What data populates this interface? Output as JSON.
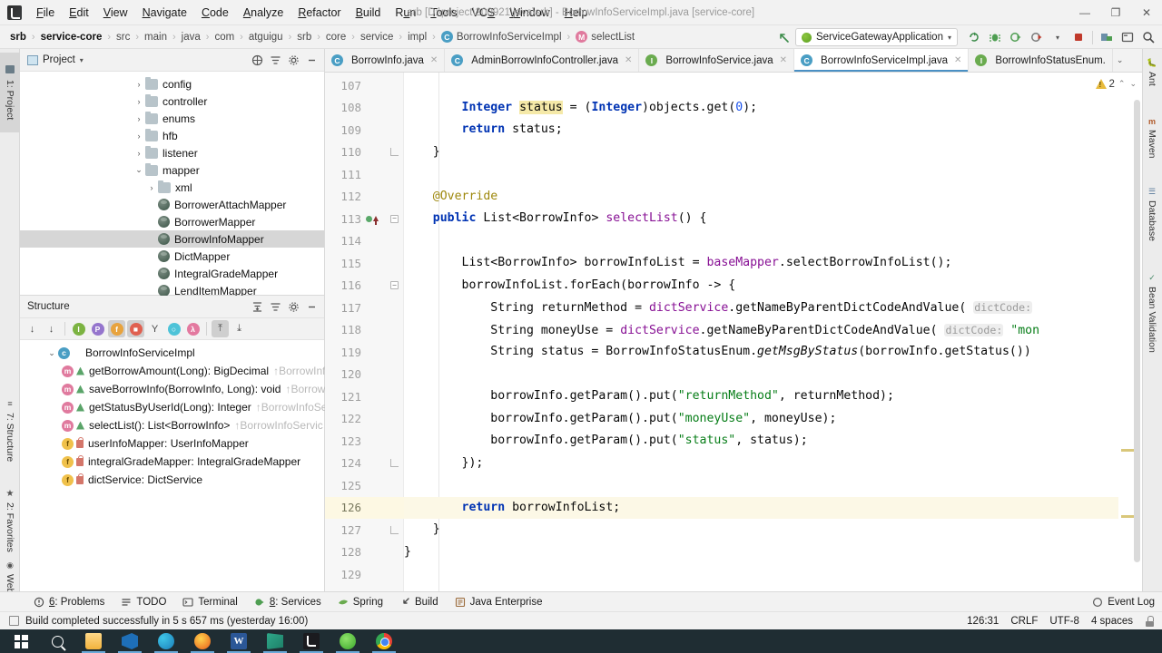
{
  "window": {
    "title": "srb [D:\\project\\200921\\java\\srb] - BorrowInfoServiceImpl.java [service-core]",
    "minimize": "—",
    "maximize": "❐",
    "close": "✕"
  },
  "menubar": {
    "items": [
      {
        "label": "File",
        "mnemonic": "F"
      },
      {
        "label": "Edit",
        "mnemonic": "E"
      },
      {
        "label": "View",
        "mnemonic": "V"
      },
      {
        "label": "Navigate",
        "mnemonic": "N"
      },
      {
        "label": "Code",
        "mnemonic": "C"
      },
      {
        "label": "Analyze",
        "mnemonic": "A"
      },
      {
        "label": "Refactor",
        "mnemonic": "R"
      },
      {
        "label": "Build",
        "mnemonic": "B"
      },
      {
        "label": "Run",
        "mnemonic": "u"
      },
      {
        "label": "Tools",
        "mnemonic": "T"
      },
      {
        "label": "VCS",
        "mnemonic": "S"
      },
      {
        "label": "Window",
        "mnemonic": "W"
      },
      {
        "label": "Help",
        "mnemonic": "H"
      }
    ]
  },
  "breadcrumb": {
    "items": [
      {
        "label": "srb",
        "style": "bold",
        "icon": ""
      },
      {
        "label": "service-core",
        "style": "bold",
        "icon": ""
      },
      {
        "label": "src",
        "style": "",
        "icon": ""
      },
      {
        "label": "main",
        "style": "",
        "icon": ""
      },
      {
        "label": "java",
        "style": "",
        "icon": ""
      },
      {
        "label": "com",
        "style": "",
        "icon": ""
      },
      {
        "label": "atguigu",
        "style": "",
        "icon": ""
      },
      {
        "label": "srb",
        "style": "",
        "icon": ""
      },
      {
        "label": "core",
        "style": "",
        "icon": ""
      },
      {
        "label": "service",
        "style": "",
        "icon": ""
      },
      {
        "label": "impl",
        "style": "",
        "icon": ""
      },
      {
        "label": "BorrowInfoServiceImpl",
        "style": "",
        "icon": "c"
      },
      {
        "label": "selectList",
        "style": "",
        "icon": "m"
      }
    ],
    "separator": "›"
  },
  "toolbar": {
    "back_arrow_icon": "back-arrow-icon",
    "run_config": "ServiceGatewayApplication",
    "run_config_caret": "▾",
    "buttons": [
      {
        "name": "build-project-icon",
        "glyph": "⟳"
      },
      {
        "name": "debug-icon",
        "glyph": "⚙"
      },
      {
        "name": "run-icon",
        "glyph": "▶"
      },
      {
        "name": "run-with-coverage-icon",
        "glyph": "▶"
      },
      {
        "name": "stop-icon",
        "glyph": "■"
      },
      {
        "name": "update-project-icon",
        "glyph": "⤓"
      },
      {
        "name": "toggle-terminal-icon",
        "glyph": "▭"
      },
      {
        "name": "search-everywhere-icon",
        "glyph": "⚲"
      }
    ]
  },
  "left_strip": {
    "tabs": [
      {
        "label": "1: Project",
        "selected": true,
        "icon": "project-folder-icon"
      },
      {
        "label": "7: Structure",
        "selected": false,
        "icon": "structure-icon"
      },
      {
        "label": "2: Favorites",
        "selected": false,
        "icon": "star-icon"
      },
      {
        "label": "Web",
        "selected": false,
        "icon": "web-icon"
      }
    ]
  },
  "right_strip": {
    "tabs": [
      {
        "label": "Ant",
        "icon": "ant-icon"
      },
      {
        "label": "Maven",
        "icon": "maven-icon"
      },
      {
        "label": "Database",
        "icon": "database-icon"
      },
      {
        "label": "Bean Validation",
        "icon": "bean-validation-icon"
      }
    ]
  },
  "project_panel": {
    "title": "Project",
    "title_caret": "▾",
    "header_icons": [
      {
        "name": "select-opened-file-icon",
        "glyph": "⊕"
      },
      {
        "name": "collapse-all-icon",
        "glyph": "≡"
      },
      {
        "name": "settings-gear-icon",
        "glyph": "⚙"
      },
      {
        "name": "hide-panel-icon",
        "glyph": "—"
      }
    ],
    "tree": [
      {
        "label": "config",
        "type": "folder",
        "indent": 2,
        "arrow": "›",
        "selected": false
      },
      {
        "label": "controller",
        "type": "folder",
        "indent": 2,
        "arrow": "›",
        "selected": false
      },
      {
        "label": "enums",
        "type": "folder",
        "indent": 2,
        "arrow": "›",
        "selected": false
      },
      {
        "label": "hfb",
        "type": "folder",
        "indent": 2,
        "arrow": "›",
        "selected": false
      },
      {
        "label": "listener",
        "type": "folder",
        "indent": 2,
        "arrow": "›",
        "selected": false
      },
      {
        "label": "mapper",
        "type": "folder",
        "indent": 2,
        "arrow": "⌄",
        "selected": false
      },
      {
        "label": "xml",
        "type": "folder",
        "indent": 3,
        "arrow": "›",
        "selected": false
      },
      {
        "label": "BorrowerAttachMapper",
        "type": "java",
        "indent": 3,
        "arrow": "",
        "selected": false
      },
      {
        "label": "BorrowerMapper",
        "type": "java",
        "indent": 3,
        "arrow": "",
        "selected": false
      },
      {
        "label": "BorrowInfoMapper",
        "type": "java",
        "indent": 3,
        "arrow": "",
        "selected": true
      },
      {
        "label": "DictMapper",
        "type": "java",
        "indent": 3,
        "arrow": "",
        "selected": false
      },
      {
        "label": "IntegralGradeMapper",
        "type": "java",
        "indent": 3,
        "arrow": "",
        "selected": false
      },
      {
        "label": "LendItemMapper",
        "type": "java",
        "indent": 3,
        "arrow": "",
        "selected": false
      }
    ]
  },
  "structure_panel": {
    "title": "Structure",
    "header_icons": [
      {
        "name": "expand-all-icon",
        "glyph": "↥"
      },
      {
        "name": "collapse-all-icon",
        "glyph": "≡"
      },
      {
        "name": "settings-gear-icon",
        "glyph": "⚙"
      },
      {
        "name": "hide-panel-icon",
        "glyph": "—"
      }
    ],
    "toolbar_icons": [
      {
        "name": "sort-by-visibility-icon",
        "glyph": "↓",
        "active": false
      },
      {
        "name": "sort-alphabetically-icon",
        "glyph": "↓",
        "active": false
      },
      {
        "name": "show-inherited-icon",
        "glyph": "I",
        "color": "green",
        "active": false
      },
      {
        "name": "show-properties-icon",
        "glyph": "P",
        "color": "purple",
        "active": false
      },
      {
        "name": "show-fields-icon",
        "glyph": "f",
        "color": "orange",
        "active": true
      },
      {
        "name": "show-non-public-icon",
        "glyph": "■",
        "color": "red",
        "active": true
      },
      {
        "name": "show-anonymous-icon",
        "glyph": "Y",
        "color": "none",
        "active": false
      },
      {
        "name": "show-ui-components-icon",
        "glyph": "○",
        "color": "cyan",
        "active": false
      },
      {
        "name": "show-lambdas-icon",
        "glyph": "λ",
        "color": "pink",
        "active": false
      },
      {
        "name": "autoscroll-to-source-icon",
        "glyph": "⤒",
        "active": true
      },
      {
        "name": "autoscroll-from-source-icon",
        "glyph": "⤓",
        "active": false
      }
    ],
    "items": [
      {
        "icon": "c",
        "vis": "",
        "label": "BorrowInfoServiceImpl",
        "muted": "",
        "indent": 1,
        "arrow": "⌄"
      },
      {
        "icon": "m",
        "vis": "pub",
        "label": "getBorrowAmount(Long): BigDecimal",
        "muted": "↑BorrowInf",
        "indent": 2,
        "arrow": ""
      },
      {
        "icon": "m",
        "vis": "pub",
        "label": "saveBorrowInfo(BorrowInfo, Long): void",
        "muted": "↑Borrow",
        "indent": 2,
        "arrow": ""
      },
      {
        "icon": "m",
        "vis": "pub",
        "label": "getStatusByUserId(Long): Integer",
        "muted": "↑BorrowInfoSe",
        "indent": 2,
        "arrow": ""
      },
      {
        "icon": "m",
        "vis": "pub",
        "label": "selectList(): List<BorrowInfo>",
        "muted": "↑BorrowInfoServic",
        "indent": 2,
        "arrow": ""
      },
      {
        "icon": "f",
        "vis": "priv",
        "label": "userInfoMapper: UserInfoMapper",
        "muted": "",
        "indent": 2,
        "arrow": ""
      },
      {
        "icon": "f",
        "vis": "priv",
        "label": "integralGradeMapper: IntegralGradeMapper",
        "muted": "",
        "indent": 2,
        "arrow": ""
      },
      {
        "icon": "f",
        "vis": "priv",
        "label": "dictService: DictService",
        "muted": "",
        "indent": 2,
        "arrow": ""
      }
    ]
  },
  "editor": {
    "tabs": [
      {
        "label": "BorrowInfo.java",
        "icon": "c",
        "active": false,
        "close": "✕"
      },
      {
        "label": "AdminBorrowInfoController.java",
        "icon": "c",
        "active": false,
        "close": "✕"
      },
      {
        "label": "BorrowInfoService.java",
        "icon": "i",
        "active": false,
        "close": "✕"
      },
      {
        "label": "BorrowInfoServiceImpl.java",
        "icon": "c",
        "active": true,
        "close": "✕"
      },
      {
        "label": "BorrowInfoStatusEnum.",
        "icon": "i",
        "active": false,
        "close": ""
      }
    ],
    "tab_overflow_caret": "⌄",
    "warning_count": "2",
    "warning_up": "⌃",
    "warning_down": "⌄",
    "first_line_number": 107,
    "current_line": 126,
    "lines": [
      {
        "n": 107,
        "html": ""
      },
      {
        "n": 108,
        "html": "        <span class=\"kw\">Integer</span> <span class=\"hl\">status</span> = (<span class=\"kw\">Integer</span>)objects.get(<span class=\"num0\">0</span>);"
      },
      {
        "n": 109,
        "html": "        <span class=\"kw\">return</span> status;"
      },
      {
        "n": 110,
        "html": "    }",
        "fold": "end"
      },
      {
        "n": 111,
        "html": ""
      },
      {
        "n": 112,
        "html": "    <span class=\"anno\">@Override</span>"
      },
      {
        "n": 113,
        "html": "    <span class=\"kw\">public</span> List&lt;BorrowInfo&gt; <span class=\"field\">selectList</span>() {",
        "fold": "open",
        "marker": "run"
      },
      {
        "n": 114,
        "html": ""
      },
      {
        "n": 115,
        "html": "        List&lt;BorrowInfo&gt; borrowInfoList = <span class=\"field\">baseMapper</span>.selectBorrowInfoList();"
      },
      {
        "n": 116,
        "html": "        borrowInfoList.forEach(borrowInfo -&gt; {",
        "fold": "open"
      },
      {
        "n": 117,
        "html": "            String returnMethod = <span class=\"field\">dictService</span>.getNameByParentDictCodeAndValue( <span class=\"hint\">dictCode:</span>"
      },
      {
        "n": 118,
        "html": "            String moneyUse = <span class=\"field\">dictService</span>.getNameByParentDictCodeAndValue( <span class=\"hint\">dictCode:</span> <span class=\"str\">\"mon</span>"
      },
      {
        "n": 119,
        "html": "            String status = BorrowInfoStatusEnum.<span class=\"ital\">getMsgByStatus</span>(borrowInfo.getStatus())"
      },
      {
        "n": 120,
        "html": ""
      },
      {
        "n": 121,
        "html": "            borrowInfo.getParam().put(<span class=\"str\">\"returnMethod\"</span>, returnMethod);"
      },
      {
        "n": 122,
        "html": "            borrowInfo.getParam().put(<span class=\"str\">\"moneyUse\"</span>, moneyUse);"
      },
      {
        "n": 123,
        "html": "            borrowInfo.getParam().put(<span class=\"str\">\"status\"</span>, status);"
      },
      {
        "n": 124,
        "html": "        });",
        "fold": "end"
      },
      {
        "n": 125,
        "html": ""
      },
      {
        "n": 126,
        "html": "        <span class=\"kw\">return</span> borrowInfoList;",
        "current": true
      },
      {
        "n": 127,
        "html": "    }",
        "fold": "end"
      },
      {
        "n": 128,
        "html": "}"
      },
      {
        "n": 129,
        "html": ""
      }
    ]
  },
  "tool_windows": {
    "items": [
      {
        "label": "6: Problems",
        "mnemonic": "6",
        "icon": "problems-icon"
      },
      {
        "label": "TODO",
        "mnemonic": "",
        "icon": "todo-icon"
      },
      {
        "label": "Terminal",
        "mnemonic": "",
        "icon": "terminal-icon"
      },
      {
        "label": "8: Services",
        "mnemonic": "8",
        "icon": "services-icon"
      },
      {
        "label": "Spring",
        "mnemonic": "",
        "icon": "spring-icon"
      },
      {
        "label": "Build",
        "mnemonic": "",
        "icon": "build-hammer-icon"
      },
      {
        "label": "Java Enterprise",
        "mnemonic": "",
        "icon": "java-enterprise-icon"
      }
    ],
    "event_log": "Event Log",
    "event_log_icon": "event-log-icon"
  },
  "status_bar": {
    "message": "Build completed successfully in 5 s 657 ms (yesterday 16:00)",
    "caret_position": "126:31",
    "line_separator": "CRLF",
    "encoding": "UTF-8",
    "indent": "4 spaces",
    "lock_icon": "read-only-lock-icon"
  },
  "taskbar": {
    "items": [
      {
        "name": "start-button",
        "icon": "windows-logo-icon"
      },
      {
        "name": "search-button",
        "icon": "search-icon"
      },
      {
        "name": "file-explorer",
        "icon": "explorer-icon",
        "running": true
      },
      {
        "name": "vscode",
        "icon": "vscode-icon",
        "running": true
      },
      {
        "name": "edge-browser",
        "icon": "edge-icon",
        "running": true
      },
      {
        "name": "firefox-browser",
        "icon": "firefox-icon",
        "running": true
      },
      {
        "name": "word",
        "icon": "word-icon",
        "running": true,
        "glyph": "W"
      },
      {
        "name": "flag-app",
        "icon": "flag-icon",
        "running": true
      },
      {
        "name": "intellij-idea",
        "icon": "intellij-icon",
        "running": true
      },
      {
        "name": "wechat",
        "icon": "wechat-icon",
        "running": true
      },
      {
        "name": "chrome-browser",
        "icon": "chrome-icon",
        "running": true
      }
    ]
  }
}
